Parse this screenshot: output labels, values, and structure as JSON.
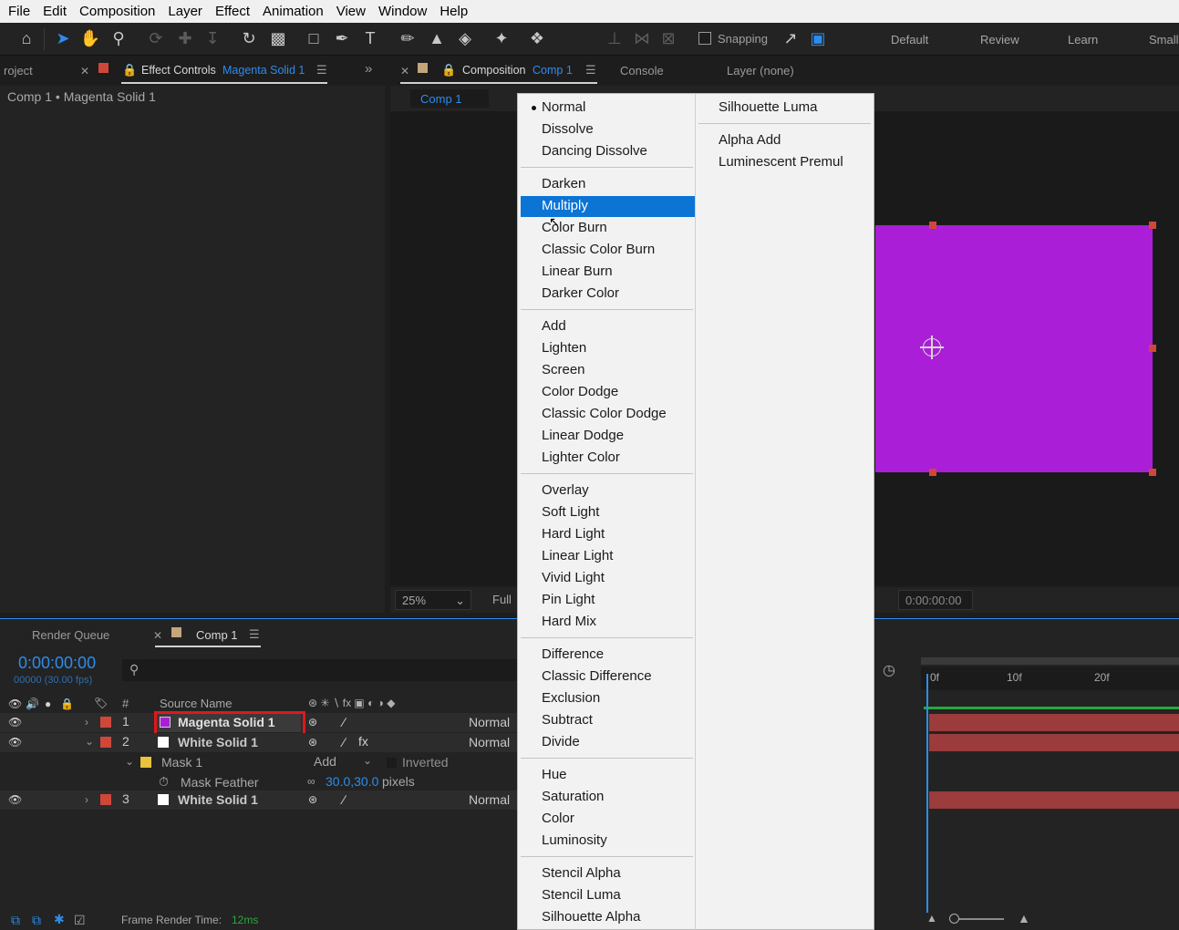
{
  "menubar": [
    "File",
    "Edit",
    "Composition",
    "Layer",
    "Effect",
    "Animation",
    "View",
    "Window",
    "Help"
  ],
  "toolbar": {
    "snapping_label": "Snapping",
    "workspaces": [
      "Default",
      "Review",
      "Learn",
      "Small"
    ]
  },
  "left_panel": {
    "project_tab": "roject",
    "effect_controls_tab": "Effect Controls",
    "effect_controls_layer": "Magenta Solid 1",
    "breadcrumb": "Comp 1 • Magenta Solid 1"
  },
  "comp_panel": {
    "composition_tab": "Composition",
    "composition_name": "Comp 1",
    "console_tab": "Console",
    "layer_tab": "Layer (none)",
    "flow_tab": "Comp 1",
    "zoom": "25%",
    "resolution": "Full",
    "timecode": "0:00:00:00"
  },
  "timeline": {
    "render_queue_tab": "Render Queue",
    "comp_tab": "Comp 1",
    "current_time": "0:00:00:00",
    "frame_info": "00000 (30.00 fps)",
    "header": {
      "num": "#",
      "source_name": "Source Name"
    },
    "layers": [
      {
        "num": "1",
        "name": "Magenta Solid 1",
        "mode": "Normal",
        "swatch": "#aa1ed8"
      },
      {
        "num": "2",
        "name": "White Solid 1",
        "mode": "Normal",
        "swatch": "#ffffff"
      },
      {
        "num": "3",
        "name": "White Solid 1",
        "mode": "Normal",
        "swatch": "#ffffff"
      }
    ],
    "mask": {
      "name": "Mask 1",
      "mode": "Add",
      "inverted_label": "Inverted"
    },
    "mask_feather": {
      "label": "Mask Feather",
      "value": "30.0,30.0",
      "unit": "pixels"
    },
    "ruler": [
      "0f",
      "10f",
      "20f"
    ],
    "frame_render_label": "Frame Render Time:",
    "frame_render_value": "12ms"
  },
  "blend_menu": {
    "selected": "Multiply",
    "groups": [
      [
        "Normal",
        "Dissolve",
        "Dancing Dissolve"
      ],
      [
        "Darken",
        "Multiply",
        "Color Burn",
        "Classic Color Burn",
        "Linear Burn",
        "Darker Color"
      ],
      [
        "Add",
        "Lighten",
        "Screen",
        "Color Dodge",
        "Classic Color Dodge",
        "Linear Dodge",
        "Lighter Color"
      ],
      [
        "Overlay",
        "Soft Light",
        "Hard Light",
        "Linear Light",
        "Vivid Light",
        "Pin Light",
        "Hard Mix"
      ],
      [
        "Difference",
        "Classic Difference",
        "Exclusion",
        "Subtract",
        "Divide"
      ],
      [
        "Hue",
        "Saturation",
        "Color",
        "Luminosity"
      ],
      [
        "Stencil Alpha",
        "Stencil Luma",
        "Silhouette Alpha"
      ]
    ],
    "col2_groups": [
      [
        "Silhouette Luma"
      ],
      [
        "Alpha Add",
        "Luminescent Premul"
      ]
    ]
  },
  "colors": {
    "accent": "#2d8ceb",
    "solid": "#aa1ed8",
    "label_red": "#d0473a",
    "highlight": "#0b74d5",
    "callout": "#e0161e"
  }
}
